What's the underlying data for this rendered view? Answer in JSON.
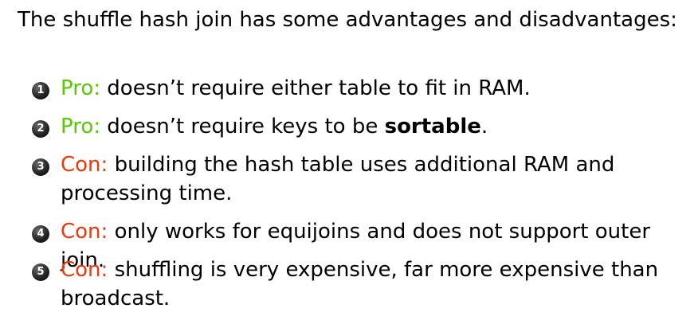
{
  "intro": "The shuffle hash join has some advantages and disadvantages:",
  "items": [
    {
      "number": "1",
      "tag": "Pro:",
      "text": "doesn’t require either table to fit in RAM."
    },
    {
      "number": "2",
      "tag": "Pro:",
      "text_before": "doesn’t require keys to be",
      "text_bold": "sortable",
      "text_after": "."
    },
    {
      "number": "3",
      "tag": "Con:",
      "text": "building the hash table uses additional RAM and processing time."
    },
    {
      "number": "4",
      "tag": "Con:",
      "text": "only works for equijoins and does not support outer join."
    },
    {
      "number": "5",
      "tag": "Con:",
      "text": "shuffling is very expensive, far more expensive than broadcast."
    }
  ],
  "colors": {
    "pro": "#5ac800",
    "con": "#e83a0e",
    "text": "#000000",
    "bullet": "#262626"
  }
}
